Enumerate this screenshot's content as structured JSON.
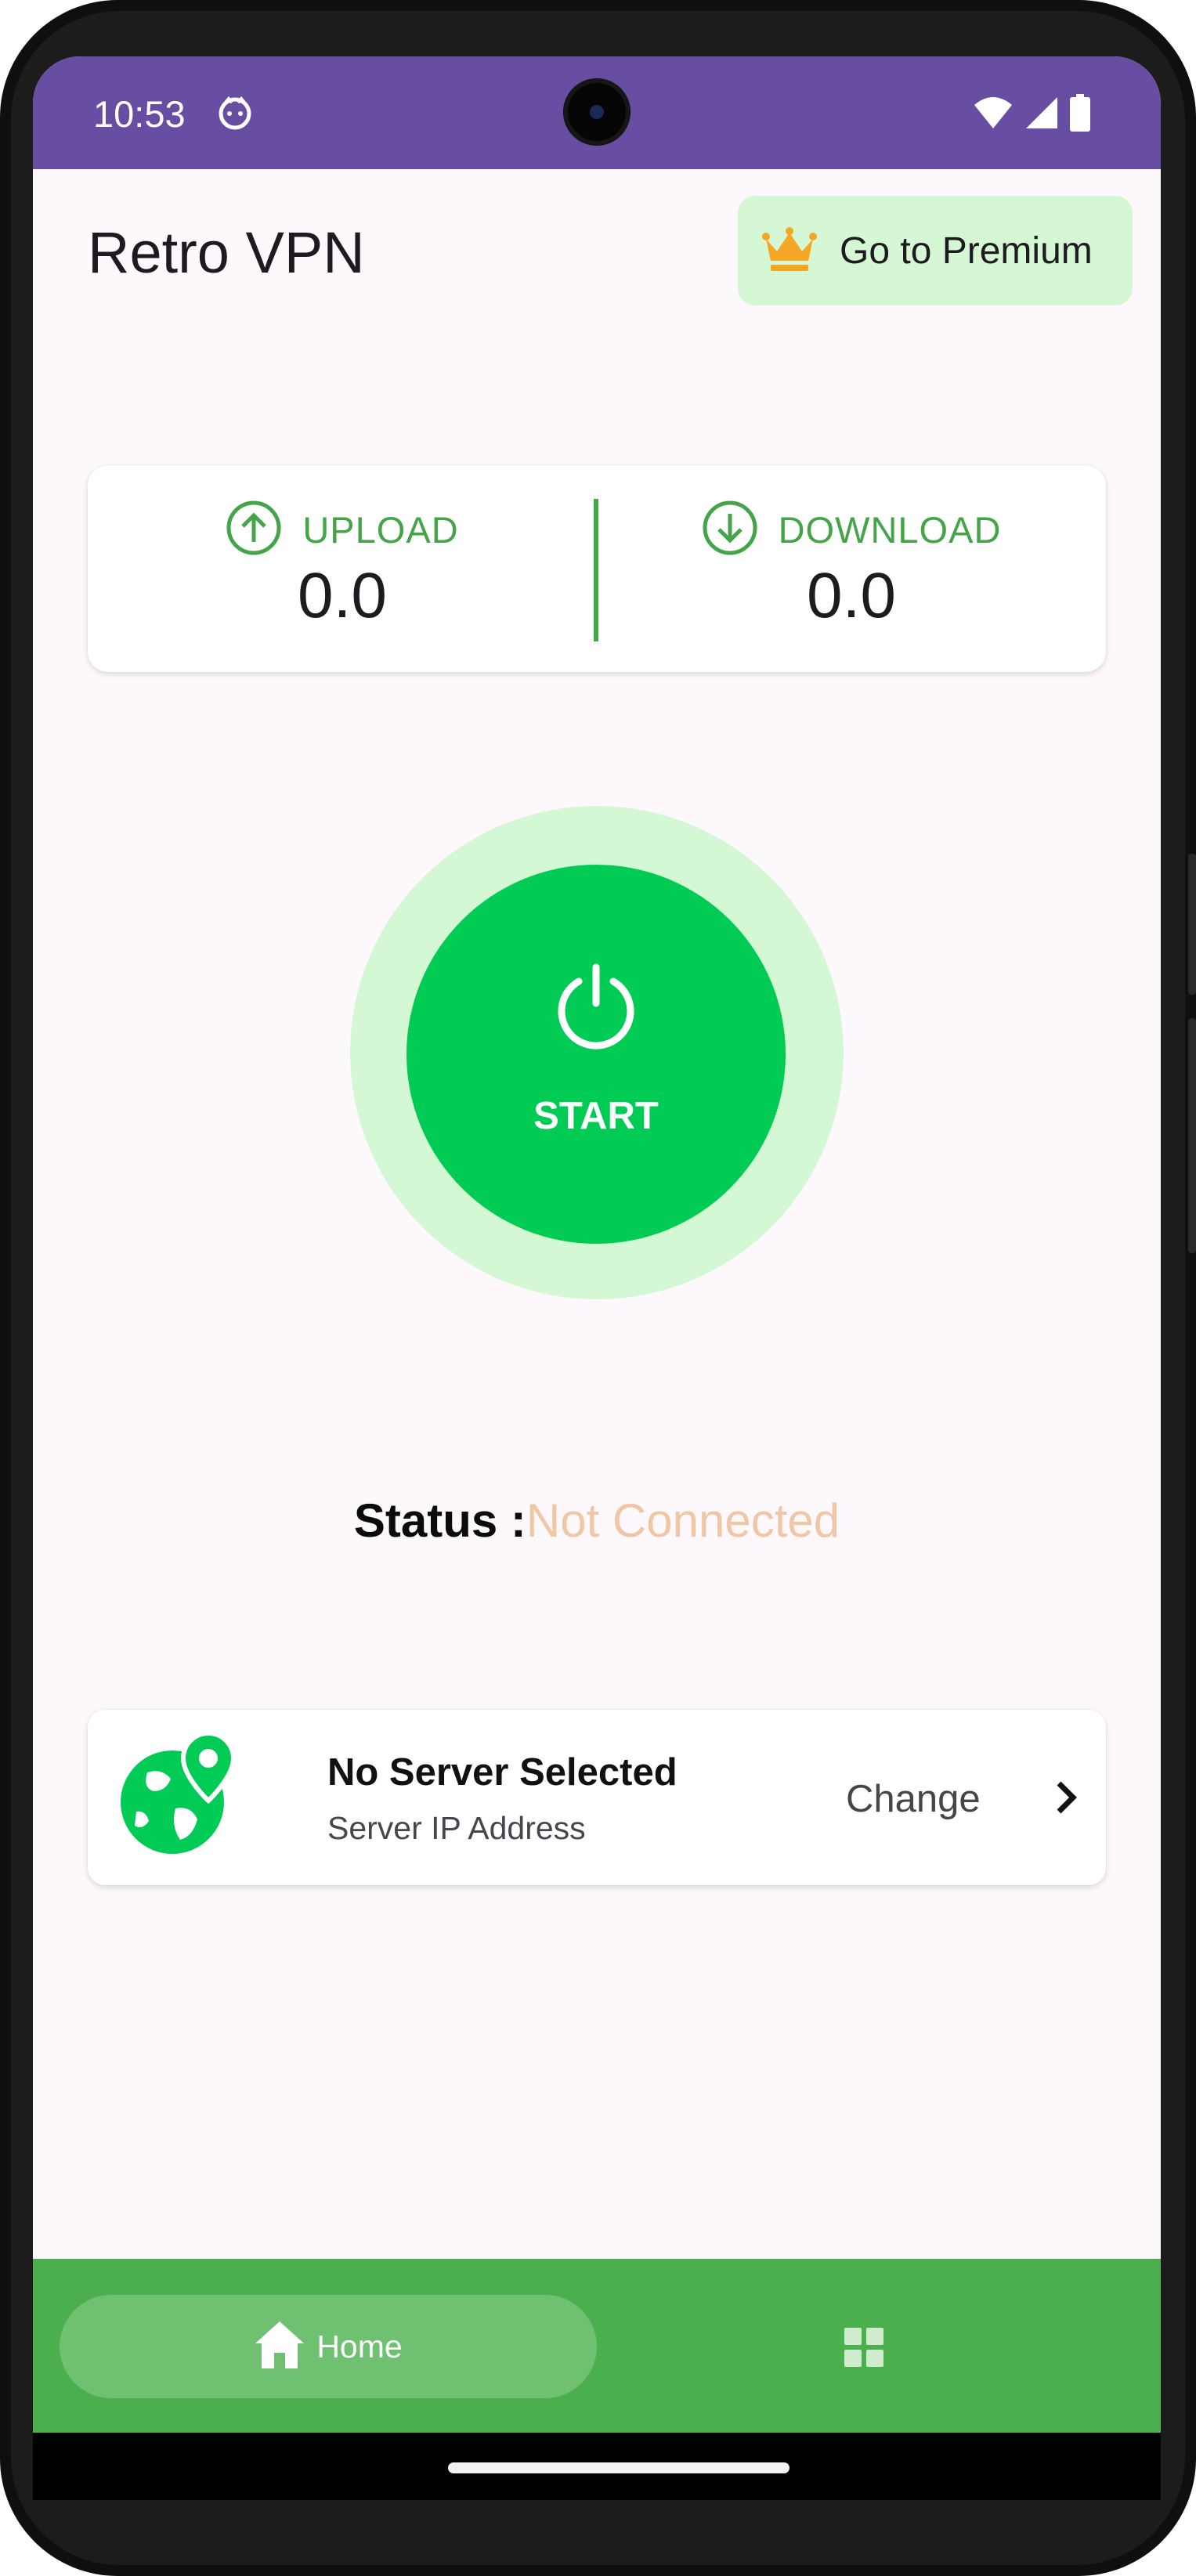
{
  "status_bar": {
    "time": "10:53"
  },
  "header": {
    "title": "Retro VPN",
    "premium_label": "Go to Premium"
  },
  "stats": {
    "upload_label": "UPLOAD",
    "upload_value": "0.0",
    "download_label": "DOWNLOAD",
    "download_value": "0.0"
  },
  "power": {
    "label": "START"
  },
  "status": {
    "key": "Status :",
    "value": "Not Connected"
  },
  "server": {
    "name": "No Server Selected",
    "ip_label": "Server IP Address",
    "change_label": "Change"
  },
  "nav": {
    "home_label": "Home"
  },
  "colors": {
    "status_bar": "#684ea3",
    "accent_green": "#00cc55",
    "nav_green": "#4caf4e",
    "status_value": "#f0c6a5"
  },
  "icons": [
    "face-icon",
    "wifi-icon",
    "signal-icon",
    "battery-icon",
    "crown-icon",
    "upload-icon",
    "download-icon",
    "power-icon",
    "globe-pin-icon",
    "chevron-right-icon",
    "home-icon",
    "grid-icon"
  ]
}
